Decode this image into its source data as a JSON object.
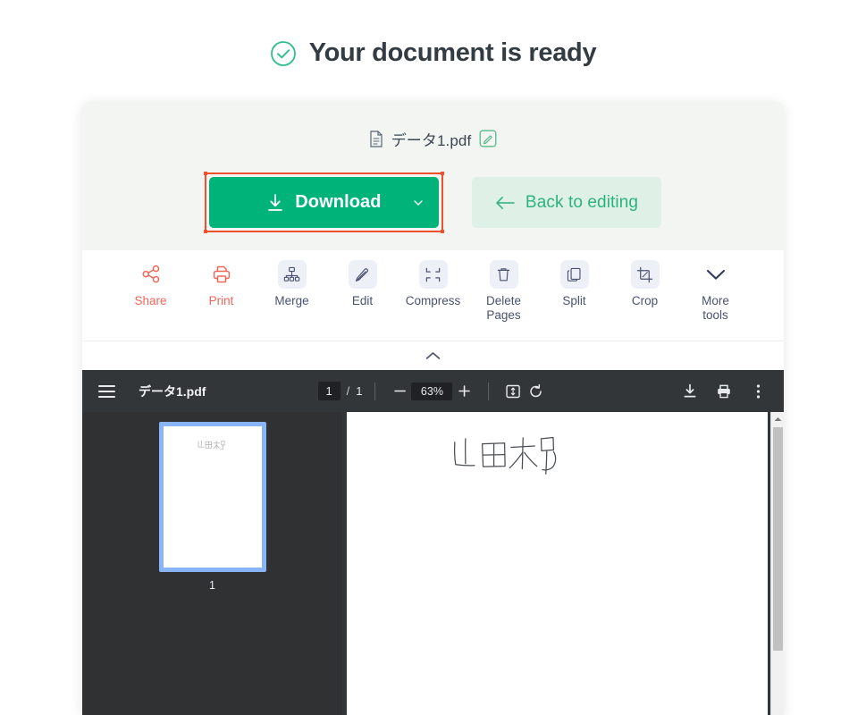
{
  "heading": {
    "icon": "check-circle-icon",
    "text": "Your document is ready",
    "accent_color": "#2fbf8f"
  },
  "file": {
    "doc_icon": "document-icon",
    "name": "データ1.pdf",
    "rename_icon": "edit-pencil-icon"
  },
  "actions": {
    "download": {
      "label": "Download",
      "icon": "download-arrow-icon",
      "caret": "chevron-down-icon",
      "color": "#00b378",
      "highlight_color": "#f0502e",
      "selected": true
    },
    "back": {
      "label": "Back to editing",
      "icon": "arrow-left-icon",
      "color": "#2cb27c",
      "background": "#dff1e7"
    }
  },
  "tools": [
    {
      "label": "Share",
      "icon": "share-nodes-icon",
      "accent": true,
      "tinted": false
    },
    {
      "label": "Print",
      "icon": "printer-icon",
      "accent": true,
      "tinted": false
    },
    {
      "label": "Merge",
      "icon": "merge-icon",
      "accent": false,
      "tinted": true
    },
    {
      "label": "Edit",
      "icon": "pencil-icon",
      "accent": false,
      "tinted": true
    },
    {
      "label": "Compress",
      "icon": "compress-icon",
      "accent": false,
      "tinted": true
    },
    {
      "label": "Delete\nPages",
      "icon": "trash-icon",
      "accent": false,
      "tinted": true
    },
    {
      "label": "Split",
      "icon": "split-icon",
      "accent": false,
      "tinted": true
    },
    {
      "label": "Crop",
      "icon": "crop-icon",
      "accent": false,
      "tinted": true
    },
    {
      "label": "More\ntools",
      "icon": "chevron-down-icon",
      "accent": false,
      "tinted": false
    }
  ],
  "collapse": {
    "icon": "chevron-up-icon"
  },
  "viewer": {
    "menu_icon": "hamburger-menu-icon",
    "filename": "データ1.pdf",
    "page_current": "1",
    "page_separator": "/",
    "page_total": "1",
    "zoom_out_icon": "minus-icon",
    "zoom_level": "63%",
    "zoom_in_icon": "plus-icon",
    "fit_page_icon": "fit-to-page-icon",
    "rotate_icon": "rotate-counterclockwise-icon",
    "download_icon": "download-icon",
    "print_icon": "print-icon",
    "more_icon": "more-vertical-icon",
    "thumbnail_page_number": "1",
    "page_content": "山田太郎"
  }
}
